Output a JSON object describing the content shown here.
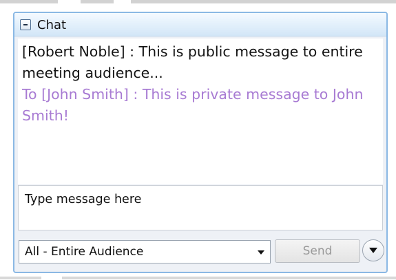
{
  "chat": {
    "title": "Chat",
    "messages": [
      {
        "type": "public",
        "text": "[Robert Noble] : This is public message to entire meeting audience..."
      },
      {
        "type": "private",
        "text": "To [John Smith] : This is private message to John Smith!"
      }
    ],
    "input": {
      "placeholder": "Type message here",
      "value": ""
    },
    "recipient_select": {
      "selected": "All - Entire Audience"
    },
    "send_label": "Send",
    "options_icon": "chevron-down-icon",
    "collapse_icon": "minus-icon"
  },
  "colors": {
    "panel_border": "#8ab8e4",
    "header_bg": "#e1effb",
    "public_message": "#141414",
    "private_message": "#a87bd3",
    "send_disabled_text": "#9a9a9a"
  }
}
